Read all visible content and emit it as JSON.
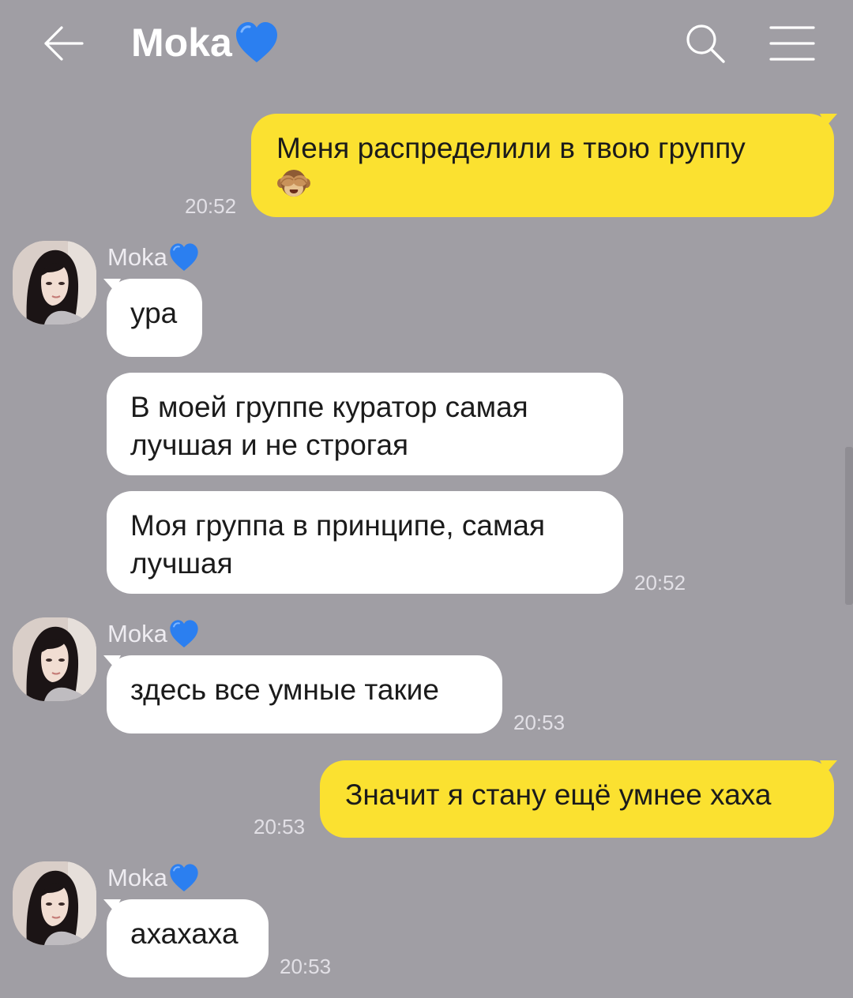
{
  "header": {
    "title": "Moka",
    "title_icon": "blue-heart-icon",
    "back_icon": "arrow-left-icon",
    "search_icon": "search-icon",
    "menu_icon": "hamburger-menu-icon"
  },
  "colors": {
    "background": "#a09ea4",
    "outgoing_bubble": "#fbe130",
    "incoming_bubble": "#ffffff",
    "heart": "#2b7ff0"
  },
  "messages": [
    {
      "from": "me",
      "line1": "Меня распределили в твою группу",
      "emoji": "see-no-evil-monkey-icon",
      "time": "20:52"
    },
    {
      "from": "Moka",
      "sender": "Moka",
      "text": "ура"
    },
    {
      "from": "Moka",
      "line1": "В моей группе куратор самая",
      "line2": "лучшая и не строгая"
    },
    {
      "from": "Moka",
      "line1": "Моя группа в принципе, самая",
      "line2": "лучшая",
      "time": "20:52"
    },
    {
      "from": "Moka",
      "sender": "Moka",
      "text": "здесь все умные такие",
      "time": "20:53"
    },
    {
      "from": "me",
      "text": "Значит я стану ещё умнее хаха",
      "time": "20:53"
    },
    {
      "from": "Moka",
      "sender": "Moka",
      "text": "ахахаха",
      "time": "20:53"
    }
  ]
}
